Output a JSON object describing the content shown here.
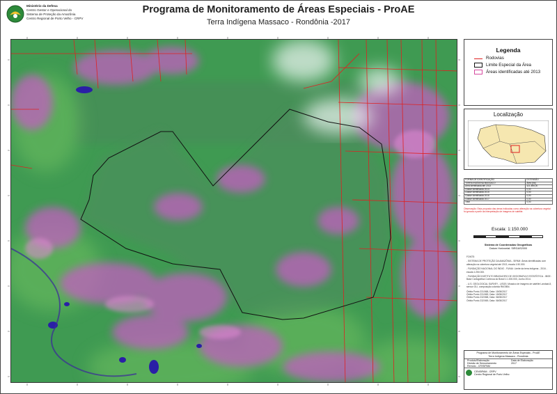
{
  "header": {
    "org_lines": [
      "Ministério da Defesa",
      "Centro Gestor e Operacional do",
      "Sistema de Proteção da Amazônia",
      "Centro Regional de Porto Velho - CRPV"
    ],
    "title": "Programa de Monitoramento de Áreas Especiais - ProAE",
    "subtitle": "Terra Indígena Massaco - Rondônia -2017"
  },
  "legend": {
    "title": "Legenda",
    "items": [
      {
        "label": "Rodovias",
        "symbol": "red-line"
      },
      {
        "label": "Limite Especial da Área",
        "symbol": "black-box"
      },
      {
        "label": "Áreas identificadas até 2013",
        "symbol": "pink-box"
      }
    ]
  },
  "location": {
    "title": "Localização"
  },
  "summary_table": {
    "header_left": "FORMA DE IDENTIFICAÇÃO",
    "header_right": "EXTENSÃO",
    "rows": [
      [
        "TERRA INDÍGENA MASSACO",
        "Área (ha)"
      ],
      [
        "Área identificada até 2013",
        "421.895,00"
      ],
      [
        "Classe identificada 2014",
        "0,00"
      ],
      [
        "Classe identificada 2015",
        "0,00"
      ],
      [
        "Classe identificada 2016",
        "0,00"
      ],
      [
        "Classe identificada 2017",
        "0,00"
      ],
      [
        "Total",
        "0,00"
      ]
    ]
  },
  "note": "Observação: Esta proposta das áreas indicadas como alteração na cobertura vegetal foi gerada a partir da interpretação de imagens de satélite.",
  "scale": {
    "label": "Escala: 1:150.000"
  },
  "coord_system": [
    "Sistema de Coordenadas Geográficas",
    "Datum Horizontal: SIRGAS2000"
  ],
  "sources": [
    "FONTE:",
    "- SISTEMA DE PROTEÇÃO DA AMAZÔNIA - SIPAM: Áreas identificadas com alteração na cobertura vegetal até 2013, escala 1:50.000.",
    "- FUNDAÇÃO NACIONAL DO ÍNDIO - FUNAI: Limite da terra indígena - 2016 - escala 1:250.000.",
    "- FUNDAÇÃO INSTITUTO BRASILEIRO DE GEOGRAFIA E ESTATÍSTICA - IBGE: Base Cartográfica Contínua do Brasil 1:1.000.000, Junho 2014.",
    "- U.S. GEOLOGICAL SURVEY - USGS: Mosaico de imagens de satélite Landsat-8, sensor OLI, composição colorida R6G5B4.",
    "Órbita Ponto 231/068, Data: 15/08/2017",
    "Órbita Ponto 231/069, Data: 15/08/2017",
    "Órbita Ponto 232/068, Data: 06/08/2017",
    "Órbita Ponto 232/069, Data: 06/08/2017"
  ],
  "footer": {
    "program": "Programa de Monitoramento de Áreas Especiais - ProAE",
    "area": "Terra Indígena Massaco - Rondônia",
    "left_label": "Produto/Elaboração",
    "left_value": "Divisão de Sensoriamento Remoto - CR/SIPAM",
    "right_label": "Data de Elaboração",
    "right_value": "2017",
    "org": "CENSIPAM - CRPV",
    "org_sub": "Centro Regional de Porto Velho"
  },
  "colors": {
    "vegetation": "#3f9a52",
    "deforestation": "#c25fc0",
    "roads": "#e02020",
    "boundary": "#111111",
    "water": "#2a1fa6"
  }
}
